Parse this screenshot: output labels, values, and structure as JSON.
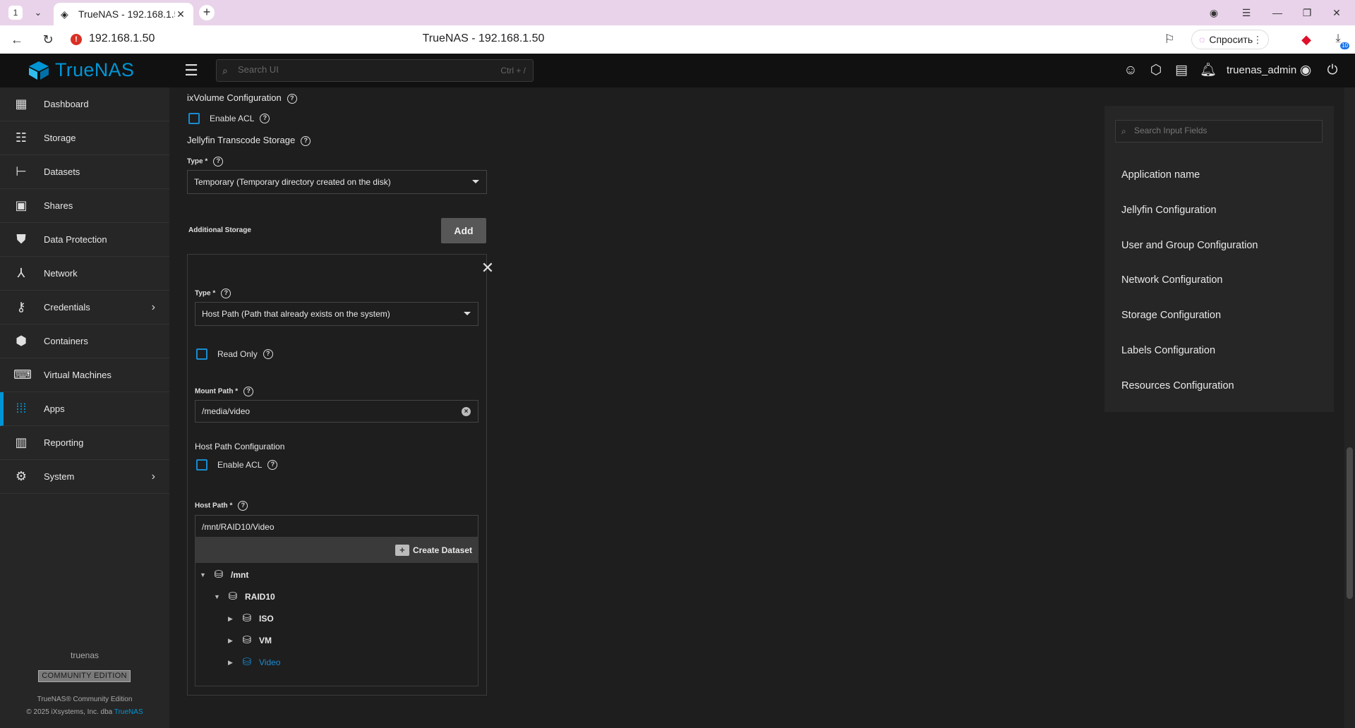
{
  "browser": {
    "tab_number": "1",
    "tab_title": "TrueNAS - 192.168.1.50",
    "url": "192.168.1.50",
    "page_title": "TrueNAS - 192.168.1.50",
    "ask_label": "Спросить",
    "download_badge": "10"
  },
  "header": {
    "logo_text": "TrueNAS",
    "search_placeholder": "Search UI",
    "search_shortcut": "Ctrl + /",
    "username": "truenas_admin"
  },
  "sidebar": {
    "items": [
      {
        "label": "Dashboard",
        "icon": "dashboard-icon"
      },
      {
        "label": "Storage",
        "icon": "storage-icon"
      },
      {
        "label": "Datasets",
        "icon": "datasets-icon"
      },
      {
        "label": "Shares",
        "icon": "shares-icon"
      },
      {
        "label": "Data Protection",
        "icon": "shield-icon"
      },
      {
        "label": "Network",
        "icon": "network-icon"
      },
      {
        "label": "Credentials",
        "icon": "key-icon"
      },
      {
        "label": "Containers",
        "icon": "cube-icon"
      },
      {
        "label": "Virtual Machines",
        "icon": "laptop-icon"
      },
      {
        "label": "Apps",
        "icon": "apps-grid-icon"
      },
      {
        "label": "Reporting",
        "icon": "chart-icon"
      },
      {
        "label": "System",
        "icon": "gear-icon"
      }
    ],
    "active": "Apps",
    "hostname": "truenas",
    "edition": "COMMUNITY EDITION",
    "copyright_line1": "TrueNAS® Community Edition",
    "copyright_line2": "© 2025 iXsystems, Inc. dba",
    "copyright_brand": "TrueNAS"
  },
  "form": {
    "ixvolume_title": "ixVolume Configuration",
    "enable_acl_label": "Enable ACL",
    "jellyfin_transcode_title": "Jellyfin Transcode Storage",
    "type_label": "Type *",
    "transcode_type_value": "Temporary (Temporary directory created on the disk)",
    "additional_storage_label": "Additional Storage",
    "add_button": "Add",
    "storage_item": {
      "type_label": "Type *",
      "type_value": "Host Path (Path that already exists on the system)",
      "read_only_label": "Read Only",
      "mount_path_label": "Mount Path *",
      "mount_path_value": "/media/video",
      "host_path_config_title": "Host Path Configuration",
      "enable_acl_label": "Enable ACL",
      "host_path_label": "Host Path *",
      "host_path_value": "/mnt/RAID10/Video",
      "create_dataset_label": "Create Dataset",
      "tree": [
        {
          "label": "/mnt",
          "toggle": "▼"
        },
        {
          "label": "RAID10",
          "toggle": "▼"
        },
        {
          "label": "ISO",
          "toggle": "▶"
        },
        {
          "label": "VM",
          "toggle": "▶"
        },
        {
          "label": "Video",
          "toggle": "▶"
        }
      ]
    }
  },
  "right_panel": {
    "search_placeholder": "Search Input Fields",
    "sections": [
      "Application name",
      "Jellyfin Configuration",
      "User and Group Configuration",
      "Network Configuration",
      "Storage Configuration",
      "Labels Configuration",
      "Resources Configuration"
    ]
  },
  "colors": {
    "accent": "#0095d5",
    "background": "#1e1e1e",
    "sidebar": "#262626",
    "topbar": "#111111"
  }
}
